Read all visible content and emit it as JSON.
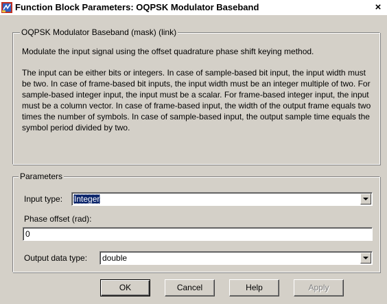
{
  "window": {
    "title": "Function Block Parameters: OQPSK Modulator Baseband",
    "close_glyph": "×",
    "title_icon": "simulink-block-icon"
  },
  "mask_group": {
    "legend": "OQPSK Modulator Baseband (mask) (link)",
    "summary": "Modulate the input signal using the offset quadrature phase shift keying method.",
    "details": "The input can be either bits or integers. In case of sample-based bit input, the input width must be two. In case of frame-based bit inputs, the input width must be an integer multiple of two. For sample-based integer input, the input must be a scalar. For frame-based integer input, the input must be a column vector. In case of frame-based input, the width of the output frame equals two times the number of symbols. In case of sample-based input, the output sample time equals the symbol period divided by two."
  },
  "parameters": {
    "legend": "Parameters",
    "input_type_label": "Input type:",
    "input_type_value": "Integer",
    "phase_offset_label": "Phase offset (rad):",
    "phase_offset_value": "0",
    "output_type_label": "Output data type:",
    "output_type_value": "double"
  },
  "buttons": {
    "ok": "OK",
    "cancel": "Cancel",
    "help": "Help",
    "apply": "Apply"
  },
  "colors": {
    "selection": "#0a246a",
    "face": "#d4d0c8"
  }
}
